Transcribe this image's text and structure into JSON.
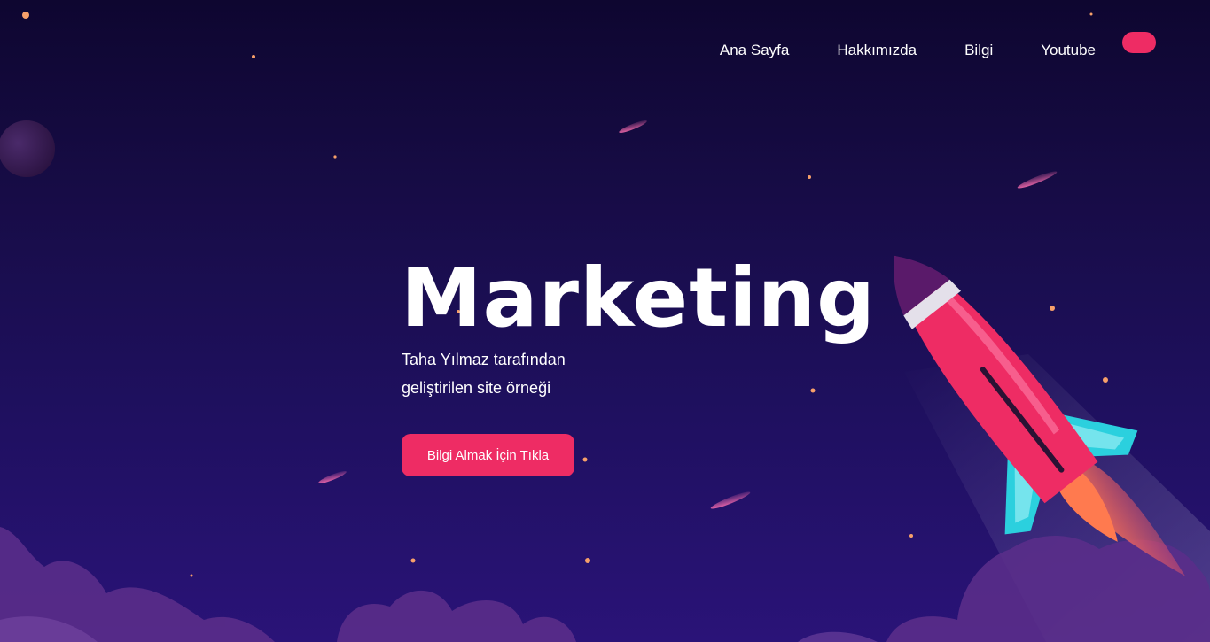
{
  "nav": {
    "items": [
      {
        "label": "Ana Sayfa"
      },
      {
        "label": "Hakkımızda"
      },
      {
        "label": "Bilgi"
      },
      {
        "label": "Youtube"
      }
    ]
  },
  "hero": {
    "title": "Marketing",
    "subtitle_line1": "Taha Yılmaz tarafından",
    "subtitle_line2": "geliştirilen site örneği",
    "cta_label": "Bilgi Almak İçin Tıkla"
  },
  "colors": {
    "background_top": "#0e0630",
    "background_bottom": "#2a1378",
    "accent": "#ee2c64",
    "rocket_fin": "#2bd0de",
    "cloud": "#5a2d8a",
    "star": "#f7a06a"
  }
}
